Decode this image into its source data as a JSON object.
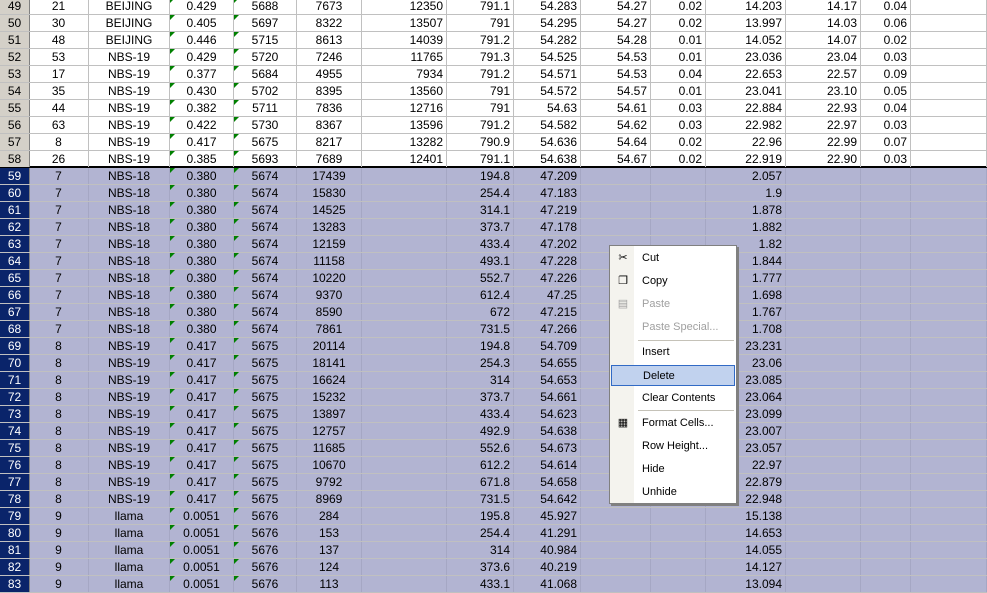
{
  "rows": [
    {
      "n": "49",
      "a": "21",
      "b": "BEIJING",
      "c": "0.429",
      "d": "5688",
      "e": "7673",
      "f": "12350",
      "g": "791.1",
      "h": "54.283",
      "i": "54.27",
      "j": "0.02",
      "k": "14.203",
      "l": "14.17",
      "m": "0.04"
    },
    {
      "n": "50",
      "a": "30",
      "b": "BEIJING",
      "c": "0.405",
      "d": "5697",
      "e": "8322",
      "f": "13507",
      "g": "791",
      "h": "54.295",
      "i": "54.27",
      "j": "0.02",
      "k": "13.997",
      "l": "14.03",
      "m": "0.06"
    },
    {
      "n": "51",
      "a": "48",
      "b": "BEIJING",
      "c": "0.446",
      "d": "5715",
      "e": "8613",
      "f": "14039",
      "g": "791.2",
      "h": "54.282",
      "i": "54.28",
      "j": "0.01",
      "k": "14.052",
      "l": "14.07",
      "m": "0.02"
    },
    {
      "n": "52",
      "a": "53",
      "b": "NBS-19",
      "c": "0.429",
      "d": "5720",
      "e": "7246",
      "f": "11765",
      "g": "791.3",
      "h": "54.525",
      "i": "54.53",
      "j": "0.01",
      "k": "23.036",
      "l": "23.04",
      "m": "0.03"
    },
    {
      "n": "53",
      "a": "17",
      "b": "NBS-19",
      "c": "0.377",
      "d": "5684",
      "e": "4955",
      "f": "7934",
      "g": "791.2",
      "h": "54.571",
      "i": "54.53",
      "j": "0.04",
      "k": "22.653",
      "l": "22.57",
      "m": "0.09"
    },
    {
      "n": "54",
      "a": "35",
      "b": "NBS-19",
      "c": "0.430",
      "d": "5702",
      "e": "8395",
      "f": "13560",
      "g": "791",
      "h": "54.572",
      "i": "54.57",
      "j": "0.01",
      "k": "23.041",
      "l": "23.10",
      "m": "0.05"
    },
    {
      "n": "55",
      "a": "44",
      "b": "NBS-19",
      "c": "0.382",
      "d": "5711",
      "e": "7836",
      "f": "12716",
      "g": "791",
      "h": "54.63",
      "i": "54.61",
      "j": "0.03",
      "k": "22.884",
      "l": "22.93",
      "m": "0.04"
    },
    {
      "n": "56",
      "a": "63",
      "b": "NBS-19",
      "c": "0.422",
      "d": "5730",
      "e": "8367",
      "f": "13596",
      "g": "791.2",
      "h": "54.582",
      "i": "54.62",
      "j": "0.03",
      "k": "22.982",
      "l": "22.97",
      "m": "0.03"
    },
    {
      "n": "57",
      "a": "8",
      "b": "NBS-19",
      "c": "0.417",
      "d": "5675",
      "e": "8217",
      "f": "13282",
      "g": "790.9",
      "h": "54.636",
      "i": "54.64",
      "j": "0.02",
      "k": "22.96",
      "l": "22.99",
      "m": "0.07"
    },
    {
      "n": "58",
      "a": "26",
      "b": "NBS-19",
      "c": "0.385",
      "d": "5693",
      "e": "7689",
      "f": "12401",
      "g": "791.1",
      "h": "54.638",
      "i": "54.67",
      "j": "0.02",
      "k": "22.919",
      "l": "22.90",
      "m": "0.03"
    },
    {
      "n": "59",
      "a": "7",
      "b": "NBS-18",
      "c": "0.380",
      "d": "5674",
      "e": "17439",
      "f": "",
      "g": "194.8",
      "h": "47.209",
      "i": "",
      "j": "",
      "k": "2.057",
      "l": "",
      "m": ""
    },
    {
      "n": "60",
      "a": "7",
      "b": "NBS-18",
      "c": "0.380",
      "d": "5674",
      "e": "15830",
      "f": "",
      "g": "254.4",
      "h": "47.183",
      "i": "",
      "j": "",
      "k": "1.9",
      "l": "",
      "m": ""
    },
    {
      "n": "61",
      "a": "7",
      "b": "NBS-18",
      "c": "0.380",
      "d": "5674",
      "e": "14525",
      "f": "",
      "g": "314.1",
      "h": "47.219",
      "i": "",
      "j": "",
      "k": "1.878",
      "l": "",
      "m": ""
    },
    {
      "n": "62",
      "a": "7",
      "b": "NBS-18",
      "c": "0.380",
      "d": "5674",
      "e": "13283",
      "f": "",
      "g": "373.7",
      "h": "47.178",
      "i": "",
      "j": "",
      "k": "1.882",
      "l": "",
      "m": ""
    },
    {
      "n": "63",
      "a": "7",
      "b": "NBS-18",
      "c": "0.380",
      "d": "5674",
      "e": "12159",
      "f": "",
      "g": "433.4",
      "h": "47.202",
      "i": "",
      "j": "",
      "k": "1.82",
      "l": "",
      "m": ""
    },
    {
      "n": "64",
      "a": "7",
      "b": "NBS-18",
      "c": "0.380",
      "d": "5674",
      "e": "11158",
      "f": "",
      "g": "493.1",
      "h": "47.228",
      "i": "",
      "j": "",
      "k": "1.844",
      "l": "",
      "m": ""
    },
    {
      "n": "65",
      "a": "7",
      "b": "NBS-18",
      "c": "0.380",
      "d": "5674",
      "e": "10220",
      "f": "",
      "g": "552.7",
      "h": "47.226",
      "i": "",
      "j": "",
      "k": "1.777",
      "l": "",
      "m": ""
    },
    {
      "n": "66",
      "a": "7",
      "b": "NBS-18",
      "c": "0.380",
      "d": "5674",
      "e": "9370",
      "f": "",
      "g": "612.4",
      "h": "47.25",
      "i": "",
      "j": "",
      "k": "1.698",
      "l": "",
      "m": ""
    },
    {
      "n": "67",
      "a": "7",
      "b": "NBS-18",
      "c": "0.380",
      "d": "5674",
      "e": "8590",
      "f": "",
      "g": "672",
      "h": "47.215",
      "i": "",
      "j": "",
      "k": "1.767",
      "l": "",
      "m": ""
    },
    {
      "n": "68",
      "a": "7",
      "b": "NBS-18",
      "c": "0.380",
      "d": "5674",
      "e": "7861",
      "f": "",
      "g": "731.5",
      "h": "47.266",
      "i": "",
      "j": "",
      "k": "1.708",
      "l": "",
      "m": ""
    },
    {
      "n": "69",
      "a": "8",
      "b": "NBS-19",
      "c": "0.417",
      "d": "5675",
      "e": "20114",
      "f": "",
      "g": "194.8",
      "h": "54.709",
      "i": "",
      "j": "",
      "k": "23.231",
      "l": "",
      "m": ""
    },
    {
      "n": "70",
      "a": "8",
      "b": "NBS-19",
      "c": "0.417",
      "d": "5675",
      "e": "18141",
      "f": "",
      "g": "254.3",
      "h": "54.655",
      "i": "",
      "j": "",
      "k": "23.06",
      "l": "",
      "m": ""
    },
    {
      "n": "71",
      "a": "8",
      "b": "NBS-19",
      "c": "0.417",
      "d": "5675",
      "e": "16624",
      "f": "",
      "g": "314",
      "h": "54.653",
      "i": "",
      "j": "",
      "k": "23.085",
      "l": "",
      "m": ""
    },
    {
      "n": "72",
      "a": "8",
      "b": "NBS-19",
      "c": "0.417",
      "d": "5675",
      "e": "15232",
      "f": "",
      "g": "373.7",
      "h": "54.661",
      "i": "",
      "j": "",
      "k": "23.064",
      "l": "",
      "m": ""
    },
    {
      "n": "73",
      "a": "8",
      "b": "NBS-19",
      "c": "0.417",
      "d": "5675",
      "e": "13897",
      "f": "",
      "g": "433.4",
      "h": "54.623",
      "i": "",
      "j": "",
      "k": "23.099",
      "l": "",
      "m": ""
    },
    {
      "n": "74",
      "a": "8",
      "b": "NBS-19",
      "c": "0.417",
      "d": "5675",
      "e": "12757",
      "f": "",
      "g": "492.9",
      "h": "54.638",
      "i": "",
      "j": "",
      "k": "23.007",
      "l": "",
      "m": ""
    },
    {
      "n": "75",
      "a": "8",
      "b": "NBS-19",
      "c": "0.417",
      "d": "5675",
      "e": "11685",
      "f": "",
      "g": "552.6",
      "h": "54.673",
      "i": "",
      "j": "",
      "k": "23.057",
      "l": "",
      "m": ""
    },
    {
      "n": "76",
      "a": "8",
      "b": "NBS-19",
      "c": "0.417",
      "d": "5675",
      "e": "10670",
      "f": "",
      "g": "612.2",
      "h": "54.614",
      "i": "",
      "j": "",
      "k": "22.97",
      "l": "",
      "m": ""
    },
    {
      "n": "77",
      "a": "8",
      "b": "NBS-19",
      "c": "0.417",
      "d": "5675",
      "e": "9792",
      "f": "",
      "g": "671.8",
      "h": "54.658",
      "i": "",
      "j": "",
      "k": "22.879",
      "l": "",
      "m": ""
    },
    {
      "n": "78",
      "a": "8",
      "b": "NBS-19",
      "c": "0.417",
      "d": "5675",
      "e": "8969",
      "f": "",
      "g": "731.5",
      "h": "54.642",
      "i": "",
      "j": "",
      "k": "22.948",
      "l": "",
      "m": ""
    },
    {
      "n": "79",
      "a": "9",
      "b": "llama",
      "c": "0.0051",
      "d": "5676",
      "e": "284",
      "f": "",
      "g": "195.8",
      "h": "45.927",
      "i": "",
      "j": "",
      "k": "15.138",
      "l": "",
      "m": ""
    },
    {
      "n": "80",
      "a": "9",
      "b": "llama",
      "c": "0.0051",
      "d": "5676",
      "e": "153",
      "f": "",
      "g": "254.4",
      "h": "41.291",
      "i": "",
      "j": "",
      "k": "14.653",
      "l": "",
      "m": ""
    },
    {
      "n": "81",
      "a": "9",
      "b": "llama",
      "c": "0.0051",
      "d": "5676",
      "e": "137",
      "f": "",
      "g": "314",
      "h": "40.984",
      "i": "",
      "j": "",
      "k": "14.055",
      "l": "",
      "m": ""
    },
    {
      "n": "82",
      "a": "9",
      "b": "llama",
      "c": "0.0051",
      "d": "5676",
      "e": "124",
      "f": "",
      "g": "373.6",
      "h": "40.219",
      "i": "",
      "j": "",
      "k": "14.127",
      "l": "",
      "m": ""
    },
    {
      "n": "83",
      "a": "9",
      "b": "llama",
      "c": "0.0051",
      "d": "5676",
      "e": "113",
      "f": "",
      "g": "433.1",
      "h": "41.068",
      "i": "",
      "j": "",
      "k": "13.094",
      "l": "",
      "m": ""
    }
  ],
  "selection": {
    "first_row": "59",
    "last_row": "83"
  },
  "context_menu": {
    "items": [
      {
        "label": "Cut",
        "icon": "scissors-icon",
        "enabled": true
      },
      {
        "label": "Copy",
        "icon": "copy-icon",
        "enabled": true
      },
      {
        "label": "Paste",
        "icon": "paste-icon",
        "enabled": false
      },
      {
        "label": "Paste Special...",
        "icon": "",
        "enabled": false
      },
      {
        "label": "Insert",
        "icon": "",
        "enabled": true
      },
      {
        "label": "Delete",
        "icon": "",
        "enabled": true,
        "highlighted": true
      },
      {
        "label": "Clear Contents",
        "icon": "",
        "enabled": true
      },
      {
        "label": "Format Cells...",
        "icon": "format-cells-icon",
        "enabled": true
      },
      {
        "label": "Row Height...",
        "icon": "",
        "enabled": true
      },
      {
        "label": "Hide",
        "icon": "",
        "enabled": true
      },
      {
        "label": "Unhide",
        "icon": "",
        "enabled": true
      }
    ]
  },
  "colors": {
    "selection": "#b2b4d2",
    "row_header_selected": "#0a246a",
    "menu_highlight": "#c1d2ee"
  }
}
